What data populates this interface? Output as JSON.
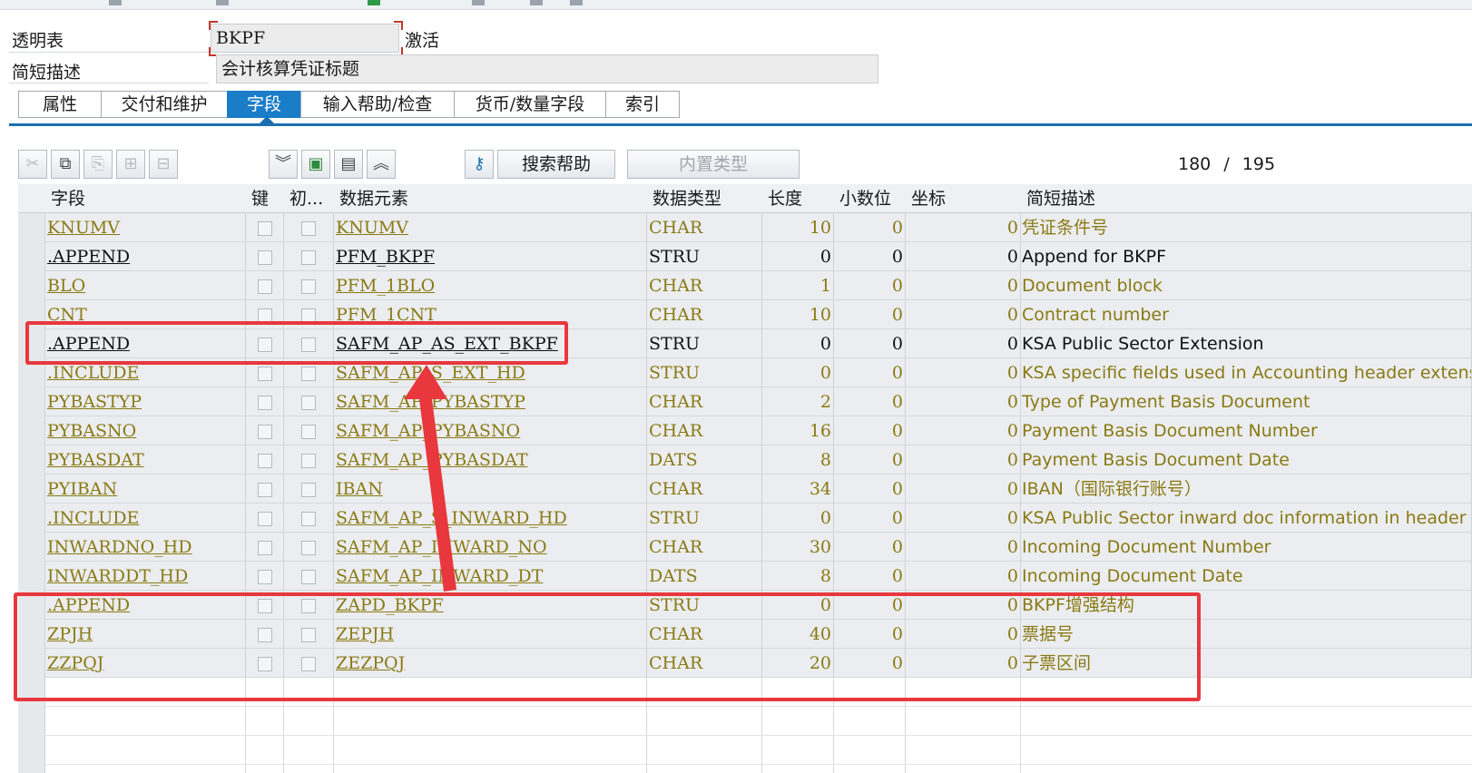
{
  "header": {
    "table_type_label": "透明表",
    "table_name": "BKPF",
    "status": "激活",
    "short_desc_label": "简短描述",
    "short_desc_value": "会计核算凭证标题"
  },
  "tabs": [
    {
      "label": "属性"
    },
    {
      "label": "交付和维护"
    },
    {
      "label": "字段"
    },
    {
      "label": "输入帮助/检查"
    },
    {
      "label": "货币/数量字段"
    },
    {
      "label": "索引"
    }
  ],
  "toolbar": {
    "icons": [
      "scissors-icon",
      "copy-icon",
      "paste-icon",
      "insert-row-icon",
      "delete-row-icon",
      "expand-down-icon",
      "insert-icon",
      "detail-icon",
      "collapse-up-icon",
      "key-help-icon"
    ],
    "search_help_label": "搜索帮助",
    "builtin_type_label": "内置类型",
    "position_current": "180",
    "position_separator": "/",
    "position_total": "195"
  },
  "columns": [
    {
      "label": "字段"
    },
    {
      "label": "键"
    },
    {
      "label": "初..."
    },
    {
      "label": "数据元素"
    },
    {
      "label": "数据类型"
    },
    {
      "label": "长度"
    },
    {
      "label": "小数位"
    },
    {
      "label": "坐标"
    },
    {
      "label": "简短描述"
    }
  ],
  "rows": [
    {
      "field": "KNUMV",
      "element": "KNUMV",
      "type": "CHAR",
      "length": "10",
      "decimals": "0",
      "coord": "0",
      "desc": "凭证条件号",
      "dark": false
    },
    {
      "field": ".APPEND",
      "element": "PFM_BKPF",
      "type": "STRU",
      "length": "0",
      "decimals": "0",
      "coord": "0",
      "desc": "Append for BKPF",
      "dark": true
    },
    {
      "field": "BLO",
      "element": "PFM_1BLO",
      "type": "CHAR",
      "length": "1",
      "decimals": "0",
      "coord": "0",
      "desc": "Document block",
      "dark": false
    },
    {
      "field": "CNT",
      "element": "PFM_1CNT",
      "type": "CHAR",
      "length": "10",
      "decimals": "0",
      "coord": "0",
      "desc": "Contract number",
      "dark": false
    },
    {
      "field": ".APPEND",
      "element": "SAFM_AP_AS_EXT_BKPF",
      "type": "STRU",
      "length": "0",
      "decimals": "0",
      "coord": "0",
      "desc": "KSA Public Sector Extension",
      "dark": true
    },
    {
      "field": ".INCLUDE",
      "element": "SAFM_AP_S_EXT_HD",
      "type": "STRU",
      "length": "0",
      "decimals": "0",
      "coord": "0",
      "desc": "KSA specific fields used in Accounting header extension",
      "dark": false
    },
    {
      "field": "PYBASTYP",
      "element": "SAFM_AP_PYBASTYP",
      "type": "CHAR",
      "length": "2",
      "decimals": "0",
      "coord": "0",
      "desc": "Type of Payment Basis Document",
      "dark": false
    },
    {
      "field": "PYBASNO",
      "element": "SAFM_AP_PYBASNO",
      "type": "CHAR",
      "length": "16",
      "decimals": "0",
      "coord": "0",
      "desc": "Payment Basis Document Number",
      "dark": false
    },
    {
      "field": "PYBASDAT",
      "element": "SAFM_AP_PYBASDAT",
      "type": "DATS",
      "length": "8",
      "decimals": "0",
      "coord": "0",
      "desc": "Payment Basis Document Date",
      "dark": false
    },
    {
      "field": "PYIBAN",
      "element": "IBAN",
      "type": "CHAR",
      "length": "34",
      "decimals": "0",
      "coord": "0",
      "desc": "IBAN（国际银行账号）",
      "dark": false
    },
    {
      "field": ".INCLUDE",
      "element": "SAFM_AP_S_INWARD_HD",
      "type": "STRU",
      "length": "0",
      "decimals": "0",
      "coord": "0",
      "desc": "KSA Public Sector inward doc information in header",
      "dark": false
    },
    {
      "field": "INWARDNO_HD",
      "element": "SAFM_AP_INWARD_NO",
      "type": "CHAR",
      "length": "30",
      "decimals": "0",
      "coord": "0",
      "desc": "Incoming Document Number",
      "dark": false
    },
    {
      "field": "INWARDDT_HD",
      "element": "SAFM_AP_INWARD_DT",
      "type": "DATS",
      "length": "8",
      "decimals": "0",
      "coord": "0",
      "desc": "Incoming Document Date",
      "dark": false
    },
    {
      "field": ".APPEND",
      "element": "ZAPD_BKPF",
      "type": "STRU",
      "length": "0",
      "decimals": "0",
      "coord": "0",
      "desc": "BKPF增强结构",
      "dark": false
    },
    {
      "field": "ZPJH",
      "element": "ZEPJH",
      "type": "CHAR",
      "length": "40",
      "decimals": "0",
      "coord": "0",
      "desc": "票据号",
      "dark": false
    },
    {
      "field": "ZZPQJ",
      "element": "ZEZPQJ",
      "type": "CHAR",
      "length": "20",
      "decimals": "0",
      "coord": "0",
      "desc": "子票区间",
      "dark": false
    }
  ],
  "colors": {
    "link_olive": "#8a7a14",
    "annotation_red": "#e8383d",
    "active_tab_blue": "#1a7dc8"
  }
}
